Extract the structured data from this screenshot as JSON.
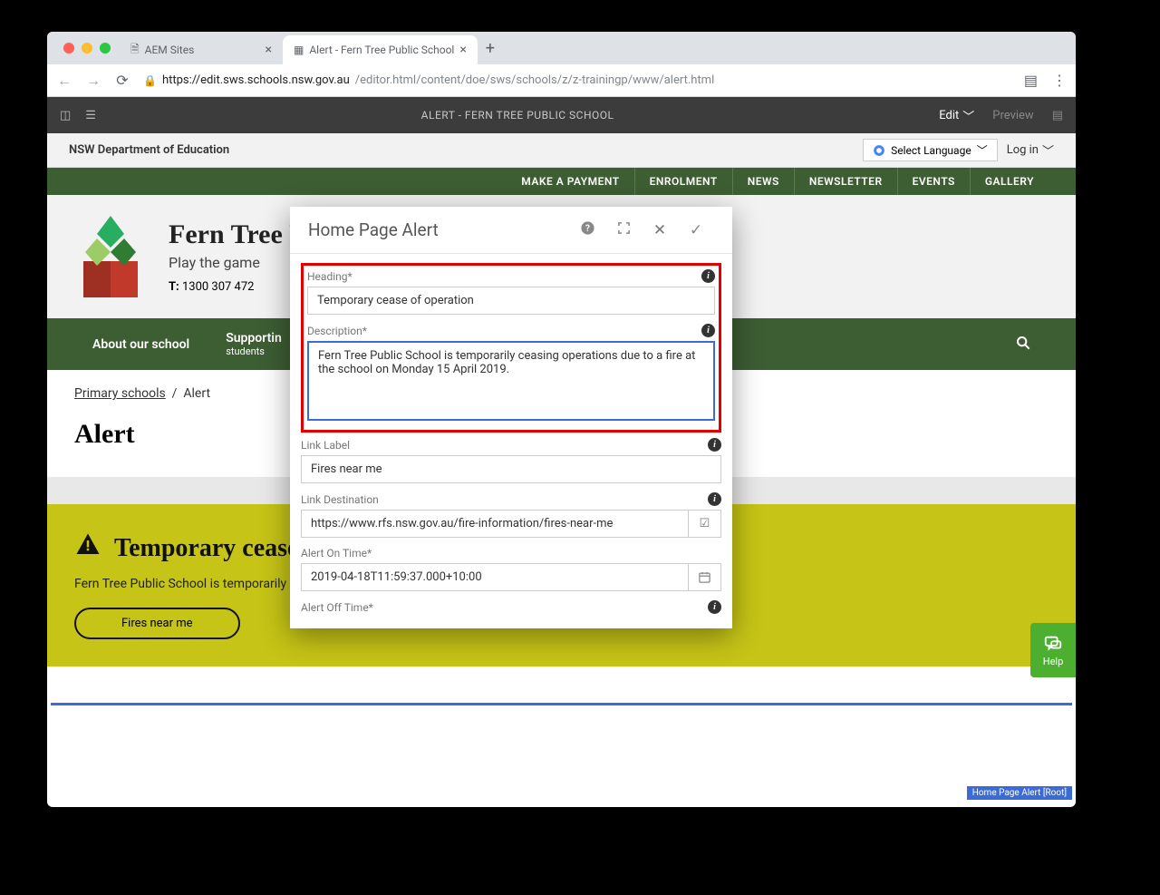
{
  "browser": {
    "tabs": [
      {
        "title": "AEM Sites",
        "active": false
      },
      {
        "title": "Alert - Fern Tree Public School",
        "active": true
      }
    ],
    "url_host": "https://edit.sws.schools.nsw.gov.au",
    "url_path": "/editor.html/content/doe/sws/schools/z/z-trainingp/www/alert.html"
  },
  "aem_bar": {
    "title": "ALERT - FERN TREE PUBLIC SCHOOL",
    "edit": "Edit",
    "preview": "Preview"
  },
  "header": {
    "dept": "NSW Department of Education",
    "lang": "Select Language",
    "login": "Log in"
  },
  "top_nav": [
    "MAKE A PAYMENT",
    "ENROLMENT",
    "NEWS",
    "NEWSLETTER",
    "EVENTS",
    "GALLERY"
  ],
  "brand": {
    "name": "Fern Tree Public School",
    "tagline": "Play the game",
    "phone_label": "T:",
    "phone": "1300 307 472"
  },
  "main_nav": {
    "about": "About our school",
    "supporting_l1": "Supportin",
    "supporting_l2": "students"
  },
  "crumbs": {
    "root": "Primary schools",
    "sep": "/",
    "current": "Alert"
  },
  "page_title": "Alert",
  "alert_banner": {
    "heading": "Temporary cease",
    "desc": "Fern Tree Public School is temporarily ceas",
    "button": "Fires near me"
  },
  "dialog": {
    "title": "Home Page Alert",
    "fields": {
      "heading_label": "Heading*",
      "heading_value": "Temporary cease of operation",
      "desc_label": "Description*",
      "desc_value": "Fern Tree Public School is temporarily ceasing operations due to a fire at the school on Monday 15 April 2019.",
      "link_label_label": "Link Label",
      "link_label_value": "Fires near me",
      "link_dest_label": "Link Destination",
      "link_dest_value": "https://www.rfs.nsw.gov.au/fire-information/fires-near-me",
      "on_time_label": "Alert On Time*",
      "on_time_value": "2019-04-18T11:59:37.000+10:00",
      "off_time_label": "Alert Off Time*"
    }
  },
  "root_label": "Home Page Alert [Root]",
  "help": "Help"
}
